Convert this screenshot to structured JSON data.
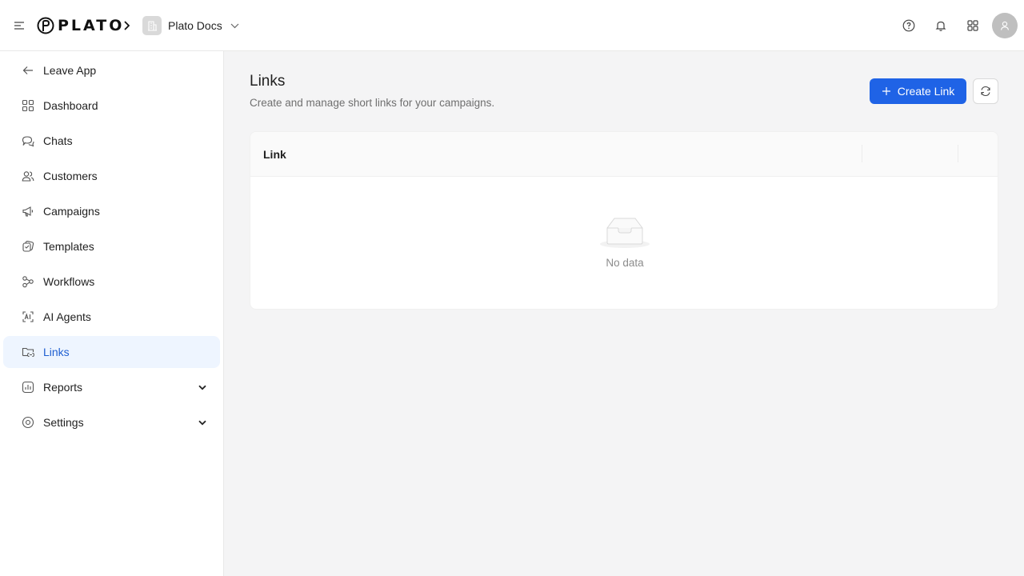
{
  "topbar": {
    "logo_text": "PLATO",
    "workspace_name": "Plato Docs"
  },
  "sidebar": {
    "items": [
      {
        "label": "Leave App",
        "icon": "arrow-left-icon"
      },
      {
        "label": "Dashboard",
        "icon": "dashboard-icon"
      },
      {
        "label": "Chats",
        "icon": "chat-icon"
      },
      {
        "label": "Customers",
        "icon": "users-icon"
      },
      {
        "label": "Campaigns",
        "icon": "megaphone-icon"
      },
      {
        "label": "Templates",
        "icon": "template-icon"
      },
      {
        "label": "Workflows",
        "icon": "workflow-icon"
      },
      {
        "label": "AI Agents",
        "icon": "ai-icon"
      },
      {
        "label": "Links",
        "icon": "link-folder-icon",
        "active": true
      },
      {
        "label": "Reports",
        "icon": "chart-icon",
        "expandable": true
      },
      {
        "label": "Settings",
        "icon": "settings-icon",
        "expandable": true
      }
    ]
  },
  "main": {
    "title": "Links",
    "subtitle": "Create and manage short links for your campaigns.",
    "create_label": "Create Link",
    "table": {
      "columns": [
        "Link",
        "",
        ""
      ],
      "empty_text": "No data"
    }
  },
  "colors": {
    "primary": "#1f63e6",
    "active_bg": "#eef5ff",
    "active_text": "#1f5fd1"
  }
}
